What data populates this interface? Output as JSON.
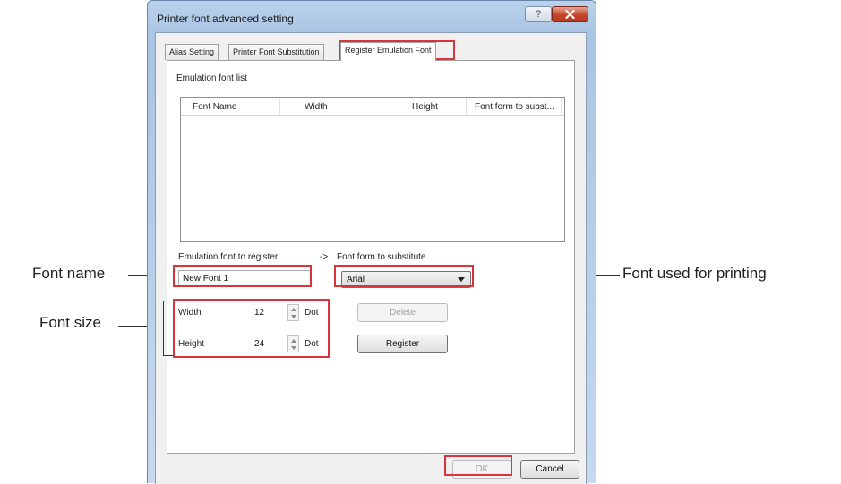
{
  "dialog": {
    "title": "Printer font advanced setting",
    "help_label": "?",
    "close_icon": "close-icon"
  },
  "tabs": [
    {
      "label": "Alias Setting",
      "active": false
    },
    {
      "label": "Printer Font Substitution",
      "active": false
    },
    {
      "label": "Register Emulation Font",
      "active": true
    }
  ],
  "list": {
    "caption": "Emulation font list",
    "columns": [
      "Font Name",
      "Width",
      "Height",
      "Font form to subst..."
    ],
    "rows": []
  },
  "register": {
    "label": "Emulation font to register",
    "arrow": "->",
    "substitute_label": "Font form to substitute",
    "font_name_value": "New Font 1",
    "substitute_value": "Arial",
    "width_label": "Width",
    "width_value": "12",
    "height_label": "Height",
    "height_value": "24",
    "unit": "Dot",
    "delete_label": "Delete",
    "register_label": "Register"
  },
  "footer": {
    "ok_label": "OK",
    "cancel_label": "Cancel"
  },
  "annotations": {
    "font_name": "Font name",
    "font_size": "Font size",
    "font_used": "Font used for printing"
  },
  "colors": {
    "highlight": "#d8343b",
    "title_bar": "#b9d1ea",
    "close_button": "#c6452b"
  }
}
